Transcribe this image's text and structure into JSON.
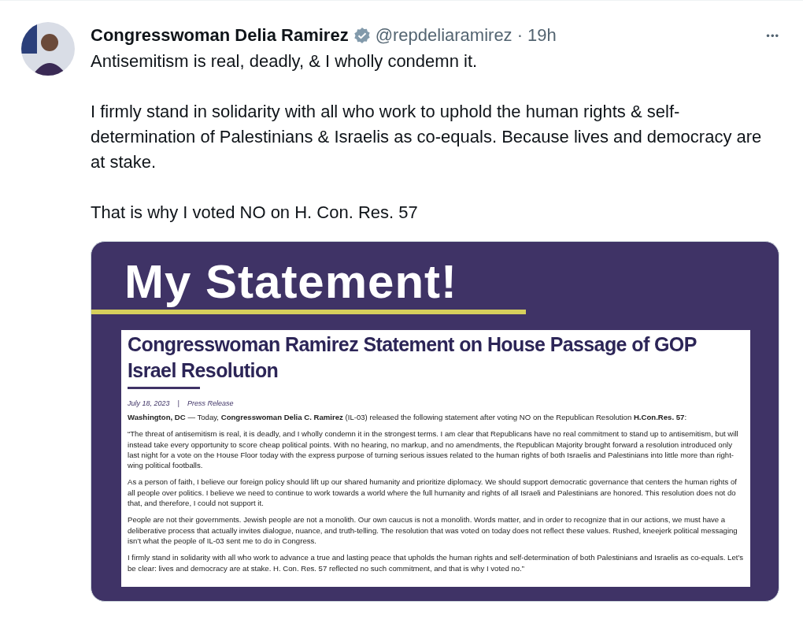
{
  "tweet": {
    "author": "Congresswoman Delia Ramirez",
    "verified": true,
    "handle": "@repdeliaramirez",
    "separator": "·",
    "time": "19h",
    "more": "•••",
    "paragraphs": [
      "Antisemitism is real, deadly, & I wholly condemn it.",
      "I firmly stand in solidarity with all who work to uphold the human rights & self-determination of Palestinians & Israelis as co-equals. Because lives and democracy are at stake.",
      "That is why I voted NO on H. Con. Res. 57"
    ]
  },
  "image": {
    "headline": "My Statement!",
    "document": {
      "title": "Congresswoman Ramirez Statement on House Passage of GOP Israel Resolution",
      "date": "July 18, 2023",
      "divider": "|",
      "category": "Press Release",
      "paragraphs": [
        "**Washington, DC** — Today, **Congresswoman Delia C. Ramirez** (IL-03) released the following statement after voting NO on the Republican Resolution **H.Con.Res. 57**:",
        "“The threat of antisemitism is real, it is deadly, and I wholly condemn it in the strongest terms. I am clear that Republicans have no real commitment to stand up to antisemitism, but will instead take every opportunity to score cheap political points. With no hearing, no markup, and no amendments, the Republican Majority brought forward a resolution introduced only last night for a vote on the House Floor today with the express purpose of turning serious issues related to the human rights of both Israelis and Palestinians into little more than right-wing political footballs.",
        "As a person of faith, I believe our foreign policy should lift up our shared humanity and prioritize diplomacy. We should support democratic governance that centers the human rights of all people over politics. I believe we need to continue to work towards a world where the full humanity and rights of all Israeli and Palestinians are honored. This resolution does not do that, and therefore, I could not support it.",
        "People are not their governments. Jewish people are not a monolith. Our own caucus is not a monolith. Words matter, and in order to recognize that in our actions, we must have a deliberative process that actually invites dialogue, nuance, and truth-telling. The resolution that was voted on today does not reflect these values. Rushed, kneejerk political messaging isn’t what the people of IL-03 sent me to do in Congress.",
        "I firmly stand in solidarity with all who work to advance a true and lasting peace that upholds the human rights and self-determination of both Palestinians and Israelis as co-equals. Let’s be clear: lives and democracy are at stake. H. Con. Res. 57 reflected no such commitment, and that is why I voted no.”"
      ]
    }
  }
}
